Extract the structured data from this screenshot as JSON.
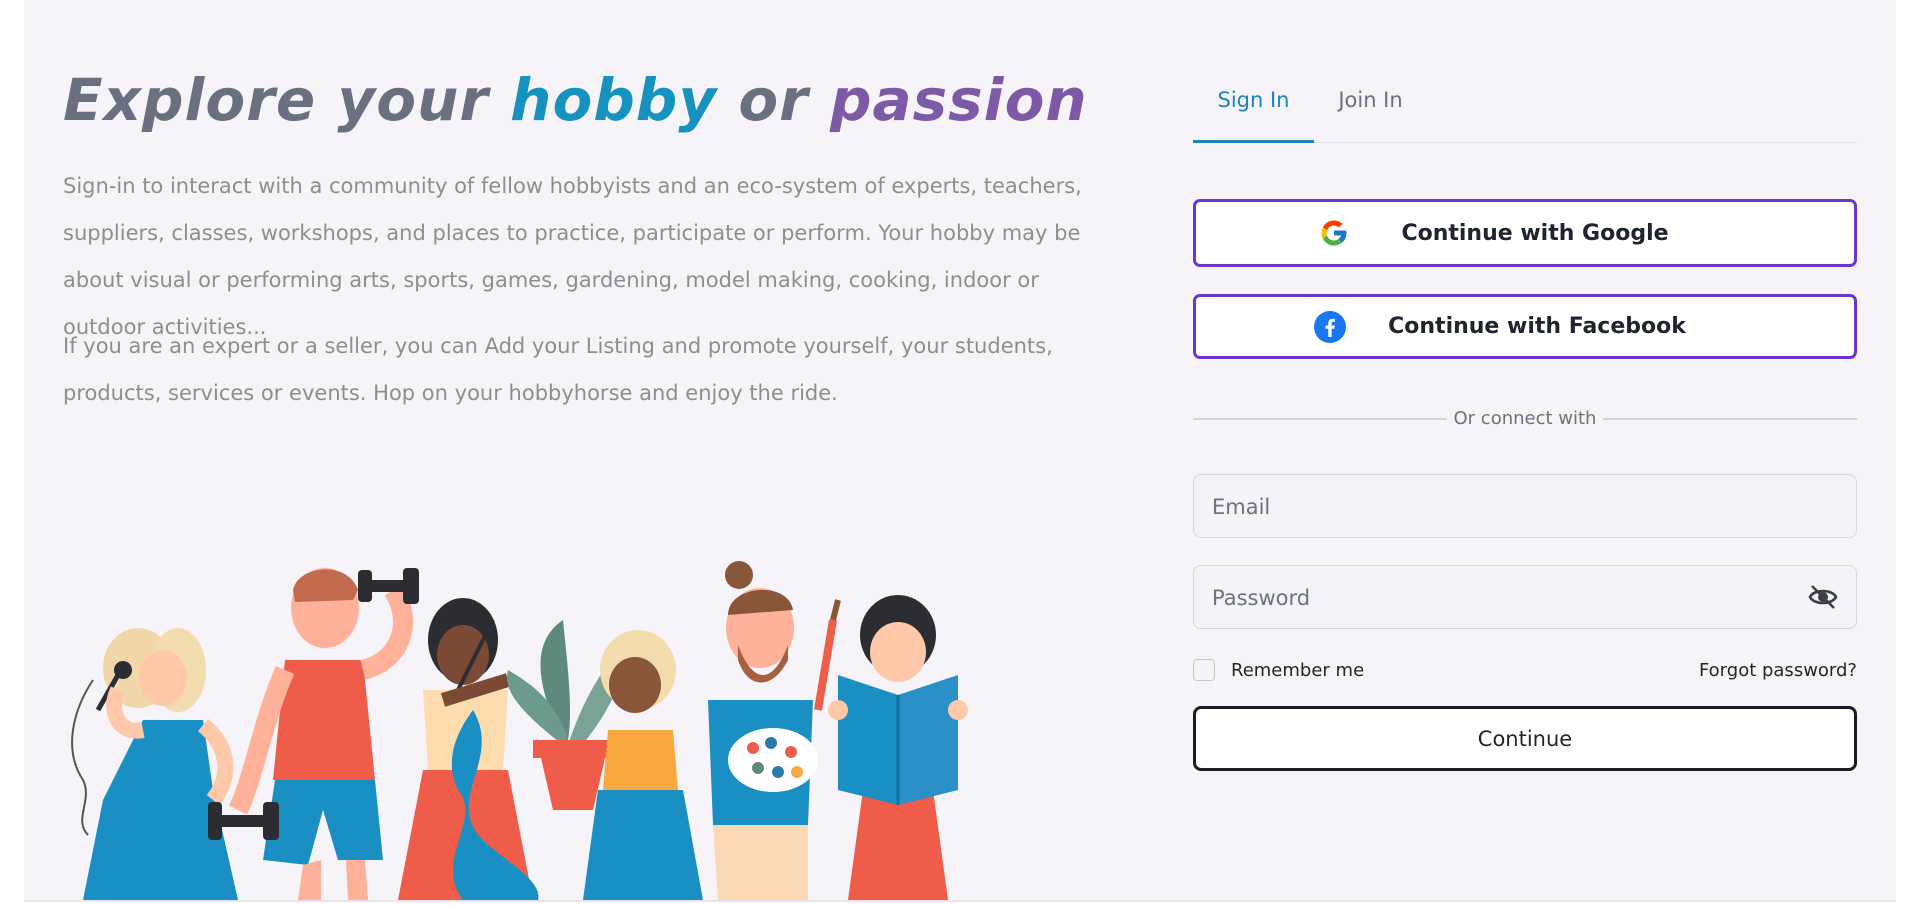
{
  "hero": {
    "title_part1": "Explore your ",
    "title_hobby": "hobby",
    "title_or": " or ",
    "title_passion": "passion",
    "paragraph1": "Sign-in to interact with a community of fellow hobbyists and an eco-system of experts, teachers, suppliers, classes, workshops, and places to practice, participate or perform. Your hobby may be about visual or performing arts, sports, games, gardening, model making, cooking, indoor or outdoor activities...",
    "paragraph2": "If you are an expert or a seller, you can Add your Listing and promote yourself, your students, products, services or events. Hop on your hobbyhorse and enjoy the ride."
  },
  "auth": {
    "tabs": {
      "sign_in": "Sign In",
      "join_in": "Join In"
    },
    "google_label": "Continue with Google",
    "facebook_label": "Continue with Facebook",
    "divider_text": "Or connect with",
    "email_placeholder": "Email",
    "password_placeholder": "Password",
    "remember_label": "Remember me",
    "forgot_label": "Forgot password?",
    "continue_label": "Continue"
  },
  "colors": {
    "accent_teal": "#1592be",
    "accent_purple": "#7c5aa6",
    "social_border": "#6b35d0",
    "background": "#f6f4f9"
  },
  "icons": {
    "google": "google-icon",
    "facebook": "facebook-icon",
    "eye_hidden": "eye-off-icon",
    "lock": "lock-icon"
  }
}
